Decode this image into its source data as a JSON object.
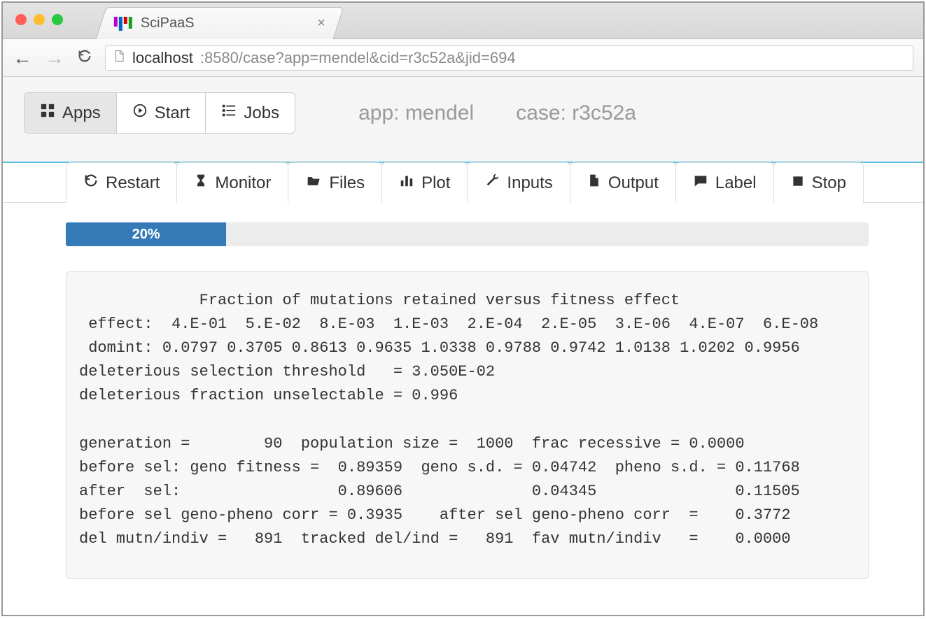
{
  "browser": {
    "tab_title": "SciPaaS",
    "url_host": "localhost",
    "url_rest": ":8580/case?app=mendel&cid=r3c52a&jid=694"
  },
  "header": {
    "buttons": {
      "apps": "Apps",
      "start": "Start",
      "jobs": "Jobs"
    },
    "info_app": "app: mendel",
    "info_case": "case: r3c52a"
  },
  "tabs": {
    "restart": "Restart",
    "monitor": "Monitor",
    "files": "Files",
    "plot": "Plot",
    "inputs": "Inputs",
    "output": "Output",
    "label": "Label",
    "stop": "Stop"
  },
  "progress": {
    "percent": 20,
    "label": "20%"
  },
  "output_text": "             Fraction of mutations retained versus fitness effect\n effect:  4.E-01  5.E-02  8.E-03  1.E-03  2.E-04  2.E-05  3.E-06  4.E-07  6.E-08\n domint: 0.0797 0.3705 0.8613 0.9635 1.0338 0.9788 0.9742 1.0138 1.0202 0.9956\ndeleterious selection threshold   = 3.050E-02\ndeleterious fraction unselectable = 0.996\n\ngeneration =        90  population size =  1000  frac recessive = 0.0000\nbefore sel: geno fitness =  0.89359  geno s.d. = 0.04742  pheno s.d. = 0.11768\nafter  sel:                 0.89606              0.04345               0.11505\nbefore sel geno-pheno corr = 0.3935    after sel geno-pheno corr  =    0.3772\ndel mutn/indiv =   891  tracked del/ind =   891  fav mutn/indiv   =    0.0000\n"
}
